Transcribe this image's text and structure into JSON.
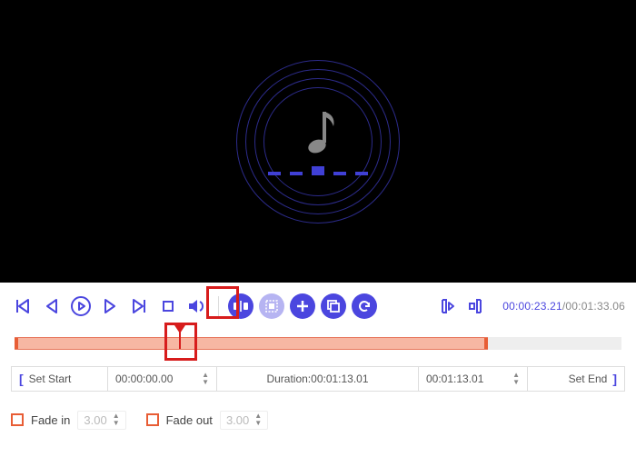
{
  "preview": {
    "icon": "music-note-icon"
  },
  "timecode": {
    "current": "00:00:23.21",
    "total": "00:01:33.06",
    "separator": "/"
  },
  "toolbar": {
    "go_start": "go-start-icon",
    "frame_back": "frame-back-icon",
    "play": "play-icon",
    "frame_fwd": "frame-fwd-icon",
    "go_end": "go-end-icon",
    "stop": "stop-icon",
    "volume": "volume-icon",
    "split": "split-icon",
    "crop": "crop-icon",
    "add": "add-icon",
    "copy": "copy-icon",
    "undo": "undo-icon",
    "mark_in": "mark-in-icon",
    "mark_out": "mark-out-icon"
  },
  "timeline": {
    "selection_start_pct": 0,
    "selection_end_pct": 78,
    "playhead_pct": 27.5
  },
  "range": {
    "set_start_label": "Set Start",
    "start_value": "00:00:00.00",
    "duration_label": "Duration:",
    "duration_value": "00:01:13.01",
    "end_value": "00:01:13.01",
    "set_end_label": "Set End"
  },
  "fade": {
    "fade_in_label": "Fade in",
    "fade_in_value": "3.00",
    "fade_out_label": "Fade out",
    "fade_out_value": "3.00"
  }
}
